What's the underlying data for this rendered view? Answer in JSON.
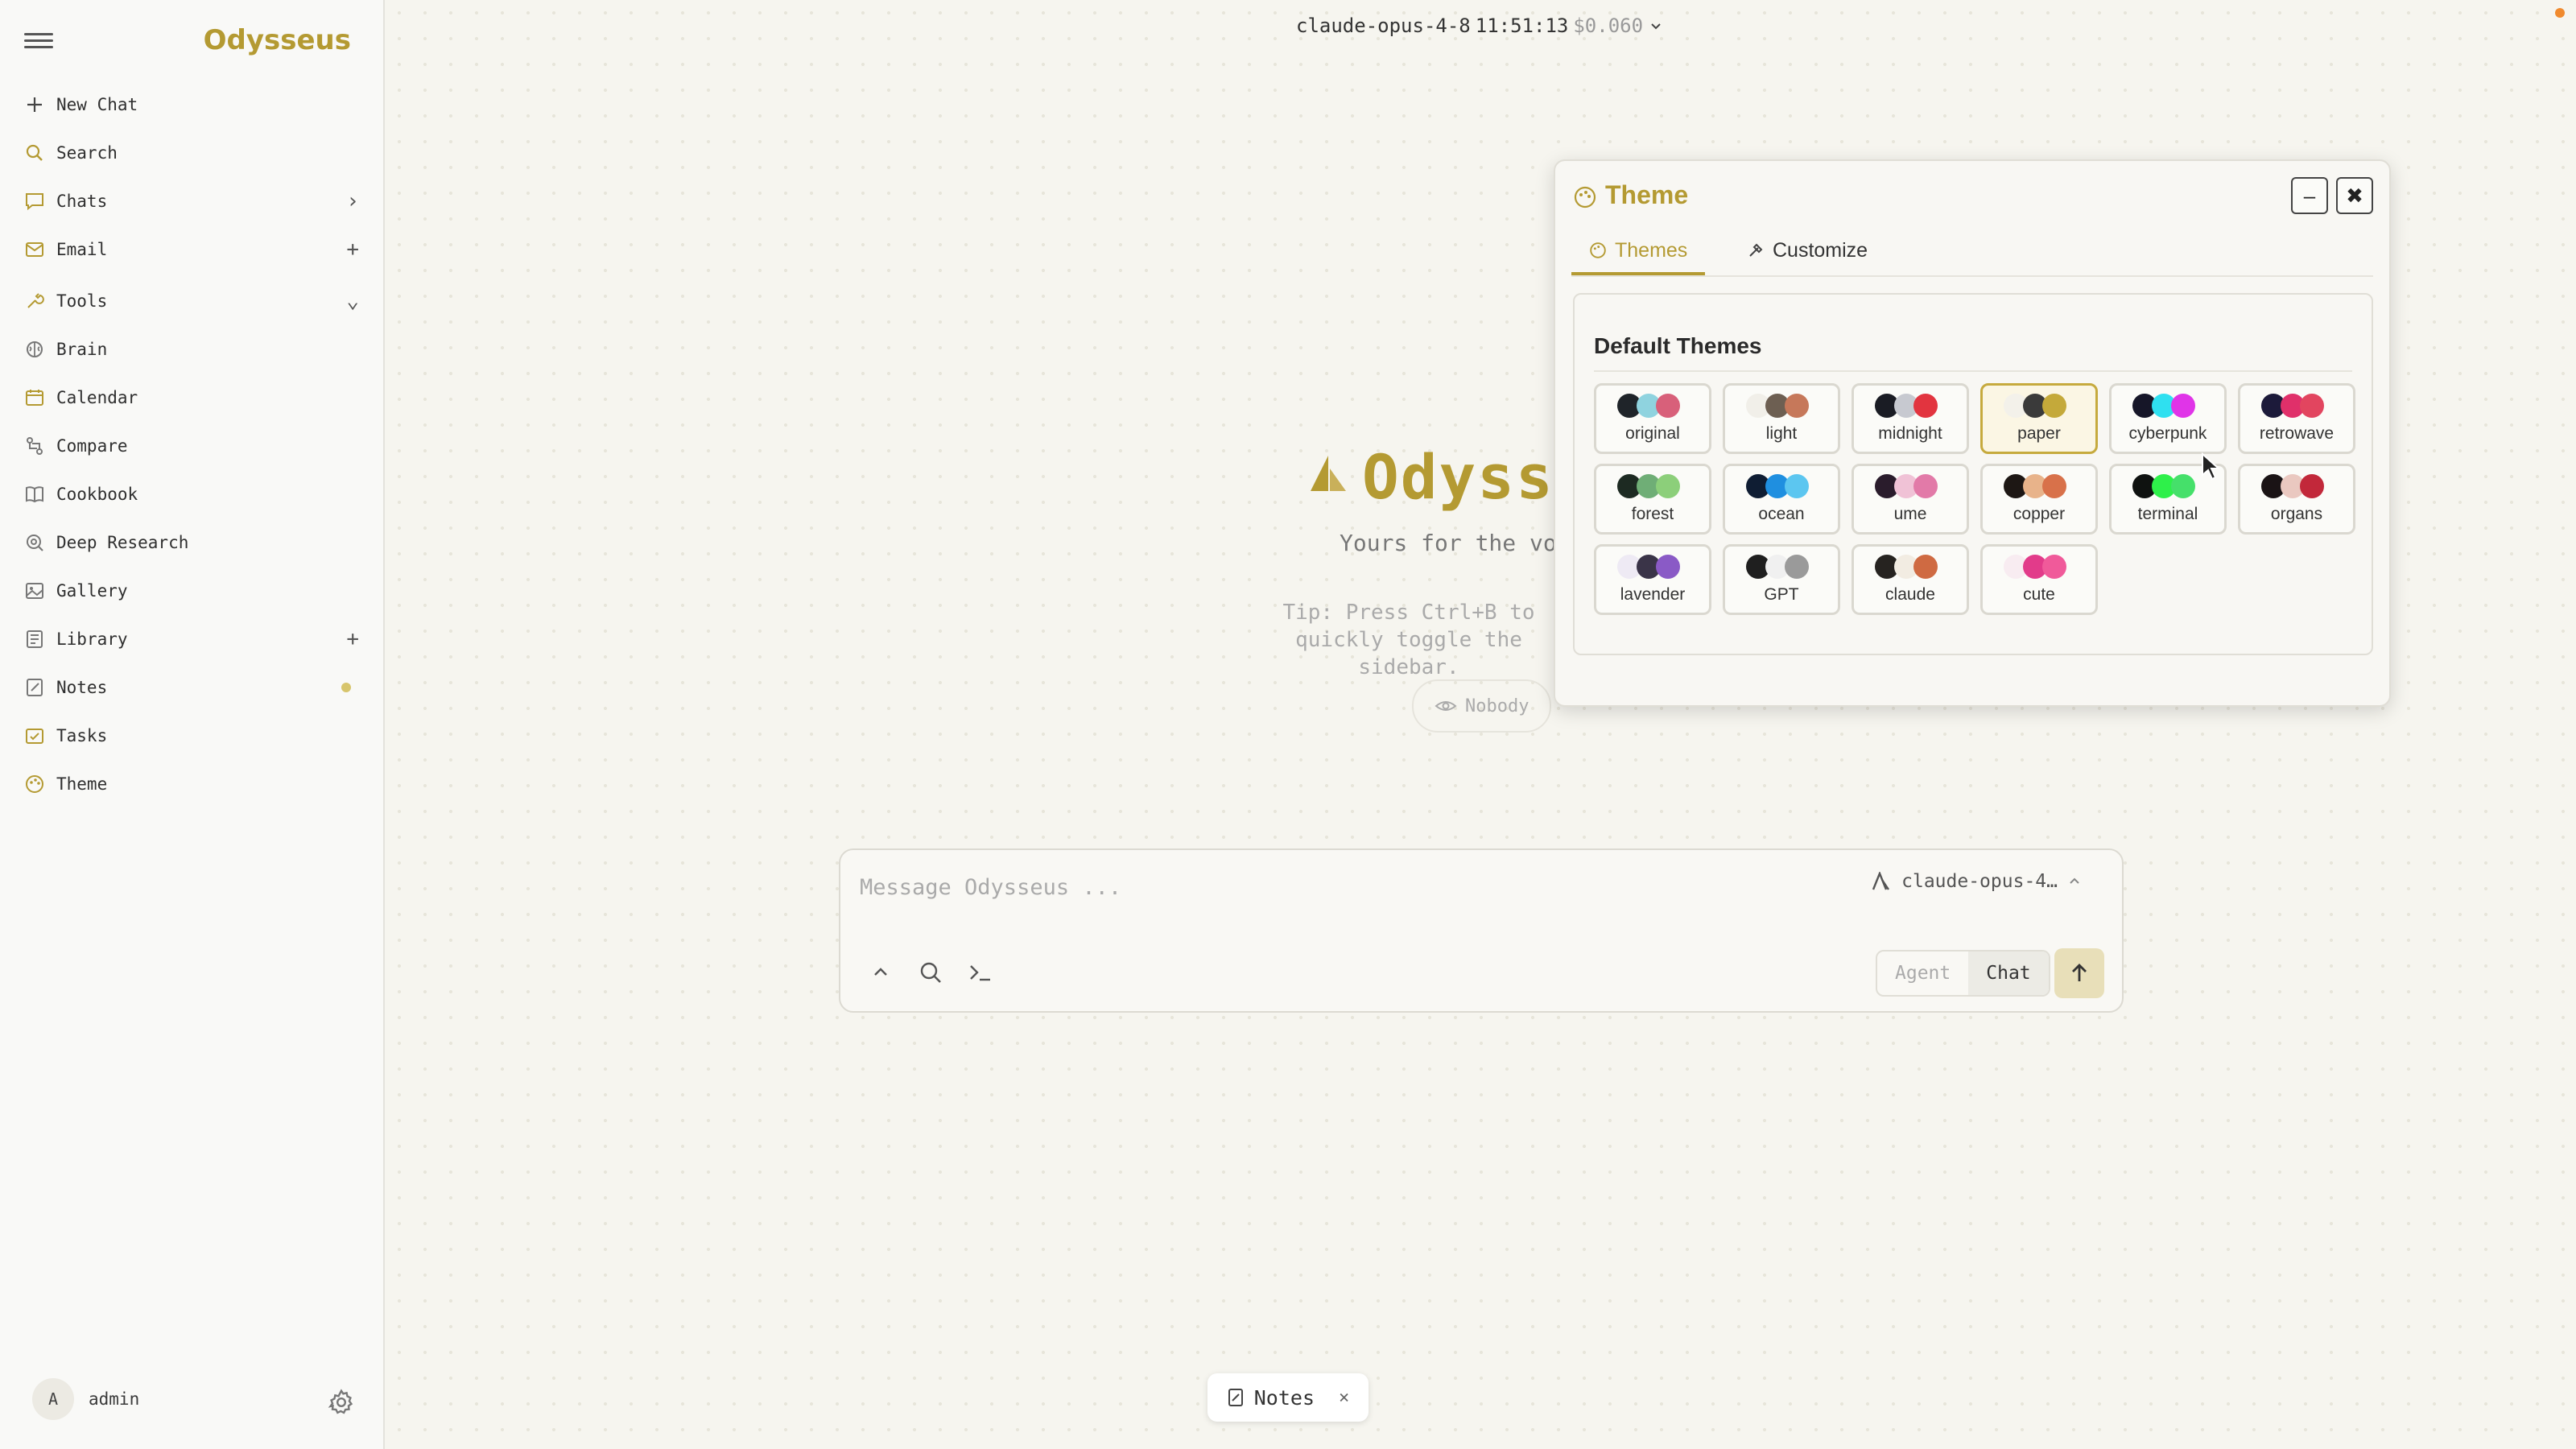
{
  "sidebar": {
    "brand": "Odysseus",
    "items": [
      {
        "label": "New Chat",
        "icon": "plus-icon",
        "trail": ""
      },
      {
        "label": "Search",
        "icon": "search-icon",
        "trail": ""
      },
      {
        "label": "Chats",
        "icon": "chat-bubble-icon",
        "trail": "›"
      },
      {
        "label": "Email",
        "icon": "mail-icon",
        "trail": "+"
      },
      {
        "label": "Tools",
        "icon": "wrench-icon",
        "trail": "⌄"
      },
      {
        "label": "Brain",
        "icon": "brain-icon",
        "trail": ""
      },
      {
        "label": "Calendar",
        "icon": "calendar-icon",
        "trail": ""
      },
      {
        "label": "Compare",
        "icon": "compare-icon",
        "trail": ""
      },
      {
        "label": "Cookbook",
        "icon": "book-icon",
        "trail": ""
      },
      {
        "label": "Deep Research",
        "icon": "research-icon",
        "trail": ""
      },
      {
        "label": "Gallery",
        "icon": "image-icon",
        "trail": ""
      },
      {
        "label": "Library",
        "icon": "library-icon",
        "trail": "+"
      },
      {
        "label": "Notes",
        "icon": "note-icon",
        "trail": ""
      },
      {
        "label": "Tasks",
        "icon": "tasks-icon",
        "trail": ""
      },
      {
        "label": "Theme",
        "icon": "palette-icon",
        "trail": ""
      }
    ],
    "user": {
      "initial": "A",
      "name": "admin"
    }
  },
  "header": {
    "model": "claude-opus-4-8",
    "time": "11:51:13",
    "cost": "$0.060"
  },
  "hero": {
    "title": "Odysseus",
    "subtitle": "Yours for the voyage",
    "tip": "Tip: Press Ctrl+B to quickly toggle the sidebar.",
    "visibility": "Nobody"
  },
  "composer": {
    "placeholder": "Message Odysseus ...",
    "model": "claude-opus-4…",
    "mode_agent": "Agent",
    "mode_chat": "Chat"
  },
  "notes_chip": {
    "label": "Notes"
  },
  "theme_dialog": {
    "title": "Theme",
    "tab_themes": "Themes",
    "tab_customize": "Customize",
    "heading": "Default Themes",
    "selected": "paper",
    "themes": [
      {
        "name": "original",
        "colors": [
          "#1f2429",
          "#8fd3df",
          "#d8607a"
        ]
      },
      {
        "name": "light",
        "colors": [
          "#f1efe9",
          "#6d5f52",
          "#c6785a"
        ]
      },
      {
        "name": "midnight",
        "colors": [
          "#1a1c24",
          "#c7c9d0",
          "#e2343f"
        ]
      },
      {
        "name": "paper",
        "colors": [
          "#f3f1ea",
          "#3a3a3a",
          "#c4a93a"
        ]
      },
      {
        "name": "cyberpunk",
        "colors": [
          "#161628",
          "#2fe0f0",
          "#e034e8"
        ]
      },
      {
        "name": "retrowave",
        "colors": [
          "#1c1a3a",
          "#e0306a",
          "#e2455f"
        ]
      },
      {
        "name": "forest",
        "colors": [
          "#1d2a22",
          "#6fae76",
          "#8ccf7a"
        ]
      },
      {
        "name": "ocean",
        "colors": [
          "#0f1d33",
          "#1f8fe0",
          "#5cc6f0"
        ]
      },
      {
        "name": "ume",
        "colors": [
          "#2a1c2c",
          "#f0c2d6",
          "#e27aa8"
        ]
      },
      {
        "name": "copper",
        "colors": [
          "#1d1714",
          "#e8b38a",
          "#d8714a"
        ]
      },
      {
        "name": "terminal",
        "colors": [
          "#0f1210",
          "#2ef04a",
          "#45e06a"
        ]
      },
      {
        "name": "organs",
        "colors": [
          "#1a1315",
          "#eac8c0",
          "#c2283a"
        ]
      },
      {
        "name": "lavender",
        "colors": [
          "#eeeaf4",
          "#3a3448",
          "#8a5ac6"
        ]
      },
      {
        "name": "GPT",
        "colors": [
          "#1f1f1f",
          "#f0f0f0",
          "#9a9a9a"
        ]
      },
      {
        "name": "claude",
        "colors": [
          "#262320",
          "#f2ece2",
          "#cf6a42"
        ]
      },
      {
        "name": "cute",
        "colors": [
          "#f8ecf1",
          "#e23b8a",
          "#f05a9a"
        ]
      }
    ]
  },
  "colors": {
    "accent": "#b49a32",
    "background": "#f6f5ef"
  }
}
